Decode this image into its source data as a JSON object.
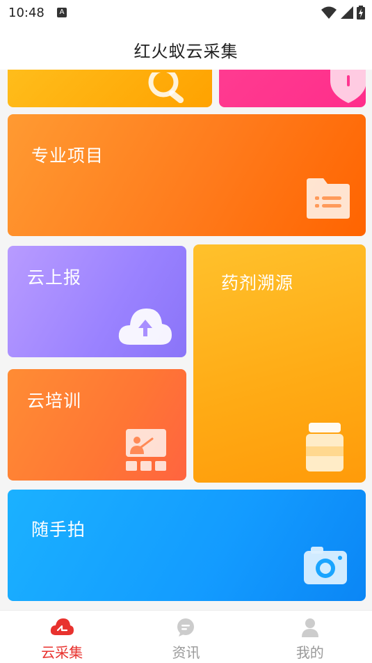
{
  "status_bar": {
    "time": "10:48",
    "notification_icon": "a-notification-icon",
    "icons": [
      "wifi-icon",
      "signal-icon",
      "battery-charging-icon"
    ]
  },
  "header": {
    "title": "红火蚁云采集"
  },
  "cards": {
    "top_left": {
      "label": "",
      "icon": "search-icon",
      "color": "#ffb00f"
    },
    "top_right": {
      "label": "",
      "icon": "shield-icon",
      "color": "#ff3590"
    },
    "pro": {
      "label": "专业项目",
      "icon": "folder-icon",
      "color": "#ff7b1c"
    },
    "report": {
      "label": "云上报",
      "icon": "cloud-upload-icon",
      "color": "#9a82ff"
    },
    "trace": {
      "label": "药剂溯源",
      "icon": "medicine-bottle-icon",
      "color": "#ffaa14"
    },
    "train": {
      "label": "云培训",
      "icon": "training-board-icon",
      "color": "#ff7634"
    },
    "snap": {
      "label": "随手拍",
      "icon": "camera-icon",
      "color": "#139bff"
    }
  },
  "tabs": [
    {
      "label": "云采集",
      "icon": "cloud-collect-icon",
      "active": true
    },
    {
      "label": "资讯",
      "icon": "message-icon",
      "active": false
    },
    {
      "label": "我的",
      "icon": "user-icon",
      "active": false
    }
  ],
  "colors": {
    "accent": "#e8322e",
    "tab_inactive": "#999999"
  }
}
